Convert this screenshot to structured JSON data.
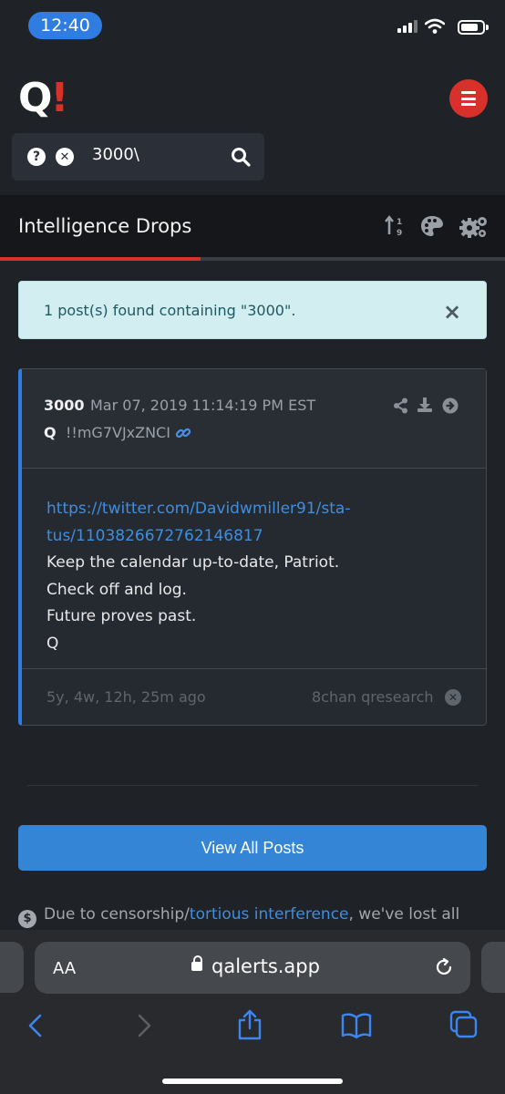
{
  "status_bar": {
    "time": "12:40"
  },
  "header": {
    "logo_q": "Q",
    "logo_bang": "!"
  },
  "search": {
    "value": "3000\\"
  },
  "section": {
    "title": "Intelligence Drops"
  },
  "alert": {
    "text": "1 post(s) found containing \"3000\".",
    "close": "×"
  },
  "post": {
    "number": "3000",
    "date": "Mar 07, 2019 11:14:19 PM EST",
    "author": "Q",
    "tripcode": "!!mG7VJxZNCI",
    "link_line1": "https://twitter.com/Davidwmiller91/sta-",
    "link_line2": "tus/1103826672762146817",
    "lines": [
      "Keep the calendar up-to-date, Patriot.",
      "Check off and log.",
      "Future proves past.",
      "Q"
    ],
    "age": "5y, 4w, 12h, 25m ago",
    "source": "8chan qresearch"
  },
  "view_all_label": "View All Posts",
  "notice": {
    "prefix": "Due to censorship/",
    "link": "tortious interference",
    "suffix": ", we've lost all"
  },
  "browser": {
    "aa": "AA",
    "url": "qalerts.app"
  },
  "colors": {
    "accent_red": "#d8302a",
    "accent_blue": "#3585d6",
    "link_blue": "#3e8ee0",
    "background": "#1f2226"
  },
  "icons": [
    "question-circle-icon",
    "times-circle-icon",
    "search-icon",
    "sort-numeric-icon",
    "palette-icon",
    "cogs-icon",
    "share-icon",
    "download-icon",
    "arrow-circle-right-icon",
    "link-icon",
    "dollar-circle-icon",
    "lock-icon",
    "reload-icon",
    "back-icon",
    "forward-icon",
    "share-sheet-icon",
    "bookmarks-icon",
    "tabs-icon"
  ]
}
